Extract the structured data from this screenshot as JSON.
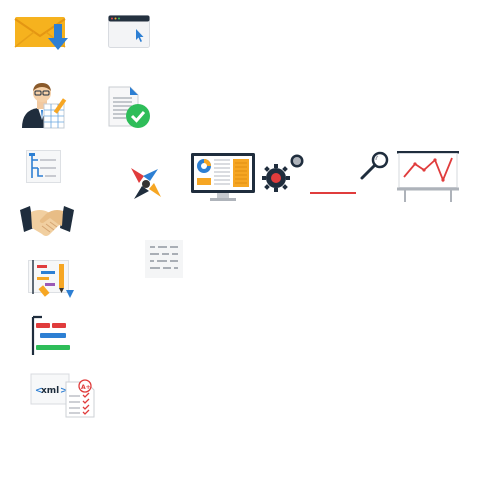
{
  "icons": [
    {
      "name": "email-download-icon"
    },
    {
      "name": "browser-window-icon"
    },
    {
      "name": "businessman-spreadsheet-icon"
    },
    {
      "name": "document-approved-icon"
    },
    {
      "name": "hierarchy-tree-icon"
    },
    {
      "name": "handshake-icon"
    },
    {
      "name": "gantt-board-icon"
    },
    {
      "name": "roadmap-chart-icon"
    },
    {
      "name": "xml-checklist-icon"
    },
    {
      "name": "pinwheel-logo-icon"
    },
    {
      "name": "text-lines-icon"
    },
    {
      "name": "dashboard-monitor-icon"
    },
    {
      "name": "gears-icon"
    },
    {
      "name": "magnifier-line-icon"
    },
    {
      "name": "presentation-board-icon"
    }
  ],
  "xml_label": "xml",
  "grade_label": "A+",
  "colors": {
    "orange": "#f6a623",
    "blue": "#2d7fd3",
    "red": "#e03c3c",
    "green": "#2ebd59",
    "navy": "#1f2d3d"
  }
}
